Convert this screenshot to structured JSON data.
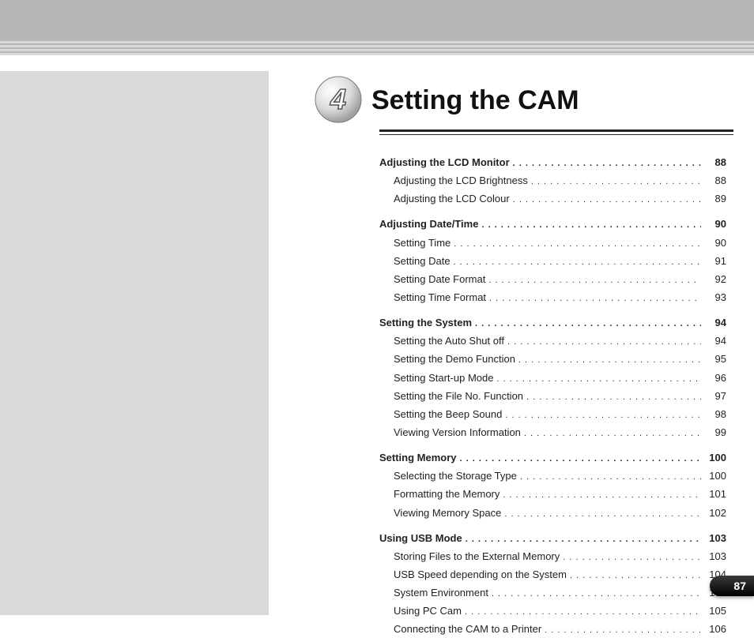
{
  "chapter": {
    "number": "4",
    "title": "Setting the CAM"
  },
  "pnum": "87",
  "sections": [
    {
      "key": "s1",
      "title": "Adjusting the LCD Monitor",
      "page": "88",
      "items": [
        {
          "key": "s1i1",
          "title": "Adjusting the LCD Brightness",
          "page": "88"
        },
        {
          "key": "s1i2",
          "title": "Adjusting the LCD Colour",
          "page": "89"
        }
      ]
    },
    {
      "key": "s2",
      "title": "Adjusting Date/Time",
      "page": "90",
      "items": [
        {
          "key": "s2i1",
          "title": "Setting Time",
          "page": "90"
        },
        {
          "key": "s2i2",
          "title": "Setting Date",
          "page": "91"
        },
        {
          "key": "s2i3",
          "title": "Setting Date Format",
          "page": "92"
        },
        {
          "key": "s2i4",
          "title": "Setting Time Format",
          "page": "93"
        }
      ]
    },
    {
      "key": "s3",
      "title": "Setting the System",
      "page": "94",
      "items": [
        {
          "key": "s3i1",
          "title": "Setting the Auto Shut off",
          "page": "94"
        },
        {
          "key": "s3i2",
          "title": "Setting the Demo Function",
          "page": "95"
        },
        {
          "key": "s3i3",
          "title": "Setting Start-up Mode",
          "page": "96"
        },
        {
          "key": "s3i4",
          "title": "Setting the File No. Function",
          "page": "97"
        },
        {
          "key": "s3i5",
          "title": "Setting the Beep Sound",
          "page": "98"
        },
        {
          "key": "s3i6",
          "title": "Viewing Version Information",
          "page": "99"
        }
      ]
    },
    {
      "key": "s4",
      "title": "Setting Memory",
      "page": "100",
      "items": [
        {
          "key": "s4i1",
          "title": "Selecting the Storage Type",
          "page": "100"
        },
        {
          "key": "s4i2",
          "title": "Formatting the Memory",
          "page": "101"
        },
        {
          "key": "s4i3",
          "title": "Viewing Memory Space",
          "page": "102"
        }
      ]
    },
    {
      "key": "s5",
      "title": "Using USB Mode",
      "page": "103",
      "items": [
        {
          "key": "s5i1",
          "title": "Storing Files to the External Memory",
          "page": "103"
        },
        {
          "key": "s5i2",
          "title": "USB Speed depending on the System",
          "page": "104"
        },
        {
          "key": "s5i3",
          "title": "System Environment",
          "page": "104"
        },
        {
          "key": "s5i4",
          "title": "Using PC Cam",
          "page": "105"
        },
        {
          "key": "s5i5",
          "title": "Connecting the CAM to a Printer",
          "page": "106"
        }
      ]
    }
  ]
}
